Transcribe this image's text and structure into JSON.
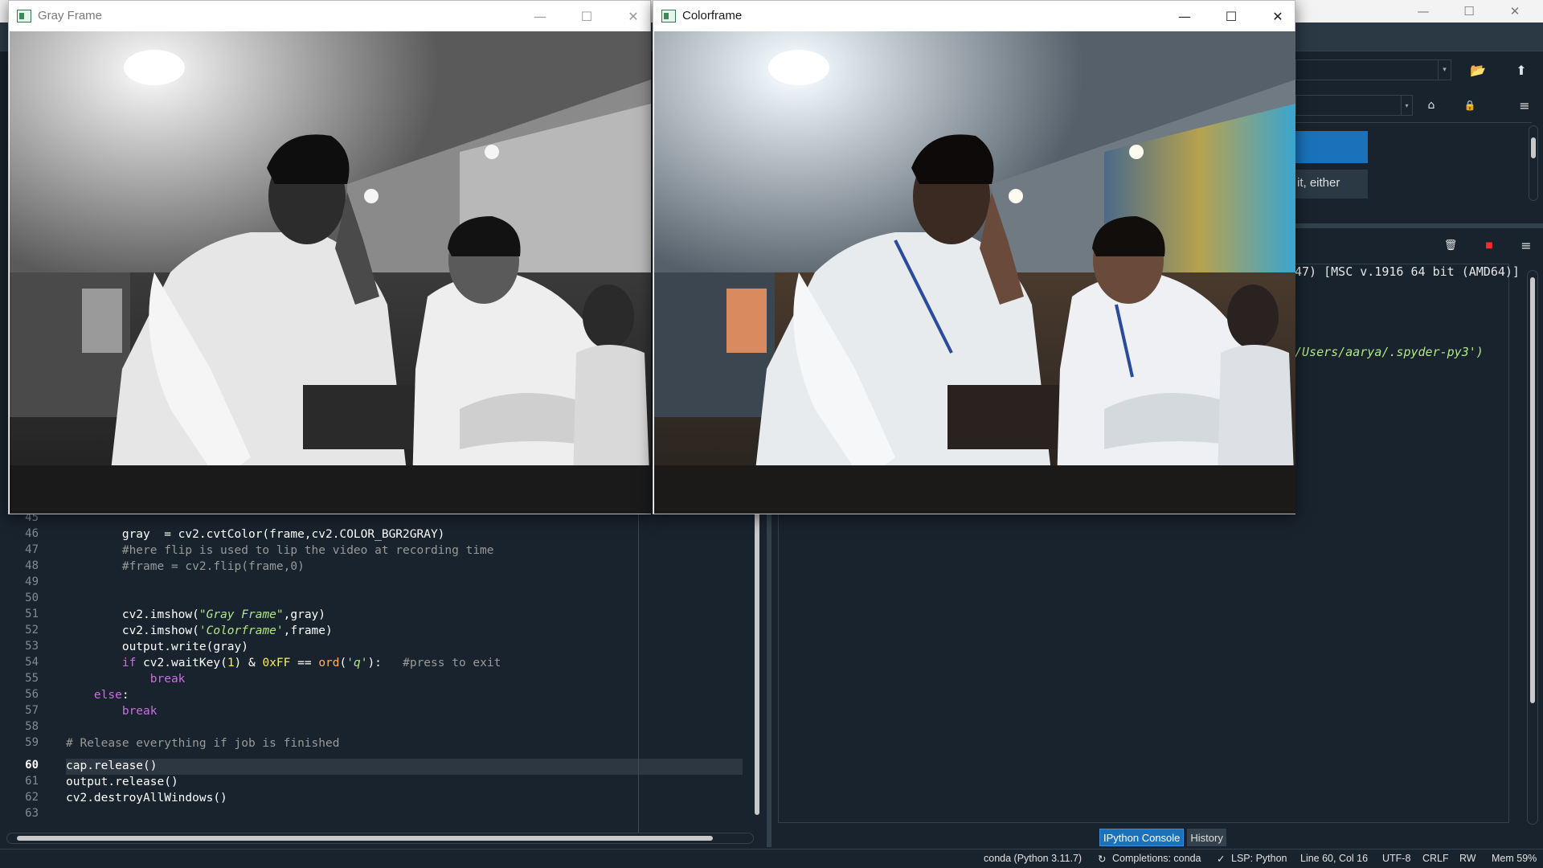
{
  "windows": {
    "gray": {
      "title": "Gray Frame"
    },
    "color": {
      "title": "Colorframe"
    }
  },
  "icons": {
    "minimize": "—",
    "maximize": "☐",
    "close": "✕",
    "folder": "📂",
    "up": "⬆",
    "home": "⌂",
    "lock": "🔒",
    "menu": "≡",
    "trash": "🗑",
    "stop": "■",
    "dropdown": "▾"
  },
  "help": {
    "text": "it, either"
  },
  "console": {
    "lines": [
      "47) [MSC v.1916 64 bit (AMD64)]",
      "/Users/aarya/.spyder-py3')"
    ],
    "tabs": [
      "IPython Console",
      "History"
    ]
  },
  "editor": {
    "line_numbers": [
      "45",
      "46",
      "47",
      "48",
      "49",
      "50",
      "51",
      "52",
      "53",
      "54",
      "55",
      "56",
      "57",
      "58",
      "59",
      "60",
      "61",
      "62",
      "63"
    ],
    "current_line": "60"
  },
  "statusbar": {
    "env": "conda (Python 3.11.7)",
    "completions": "Completions: conda",
    "lsp": "LSP: Python",
    "position": "Line 60, Col 16",
    "encoding": "UTF-8",
    "eol": "CRLF",
    "mode": "RW",
    "mem": "Mem 59%"
  },
  "colors": {
    "spyder_bg": "#19232d",
    "accent": "#1a72bb",
    "stop_red": "#ff0000"
  }
}
